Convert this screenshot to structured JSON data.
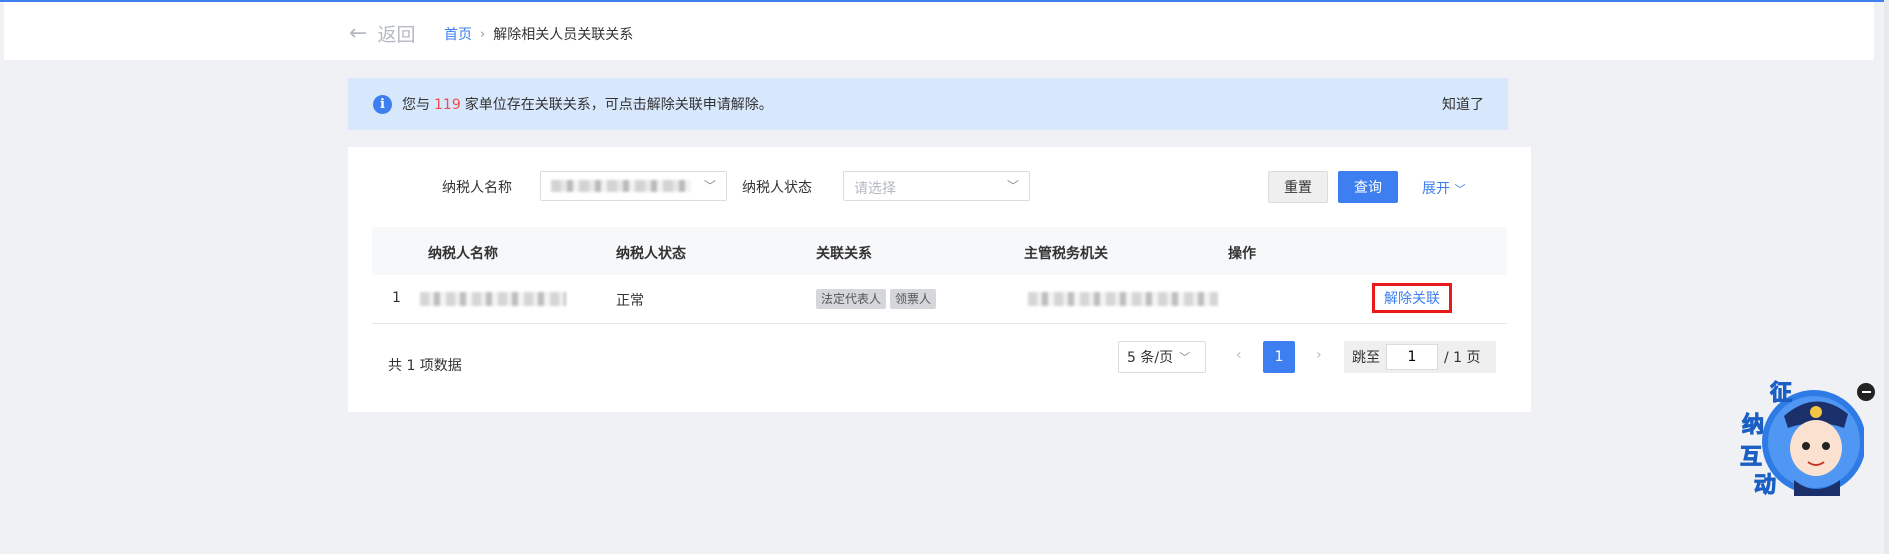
{
  "header": {
    "back_label": "返回",
    "breadcrumb": {
      "home": "首页",
      "current": "解除相关人员关联关系"
    }
  },
  "notice": {
    "prefix": "您与",
    "count": "119",
    "suffix": "家单位存在关联关系，可点击解除关联申请解除。",
    "dismiss_label": "知道了"
  },
  "filters": {
    "name_label": "纳税人名称",
    "status_label": "纳税人状态",
    "status_placeholder": "请选择",
    "reset_label": "重置",
    "query_label": "查询",
    "expand_label": "展开"
  },
  "table": {
    "headers": [
      "纳税人名称",
      "纳税人状态",
      "关联关系",
      "主管税务机关",
      "操作"
    ],
    "rows": [
      {
        "index": "1",
        "status": "正常",
        "tags": [
          "法定代表人",
          "领票人"
        ],
        "action": "解除关联"
      }
    ]
  },
  "pagination": {
    "total_text": "共 1 项数据",
    "page_size": "5 条/页",
    "prev": "‹",
    "next": "›",
    "current_page": "1",
    "jump_label": "跳至",
    "jump_value": "1",
    "total_pages_text": "/ 1 页"
  },
  "mascot": {
    "chars": [
      "征",
      "纳",
      "互",
      "动"
    ]
  },
  "colors": {
    "primary": "#3d7ff0",
    "danger": "#ea1a1a",
    "notice_bg": "#d7e7fc"
  }
}
